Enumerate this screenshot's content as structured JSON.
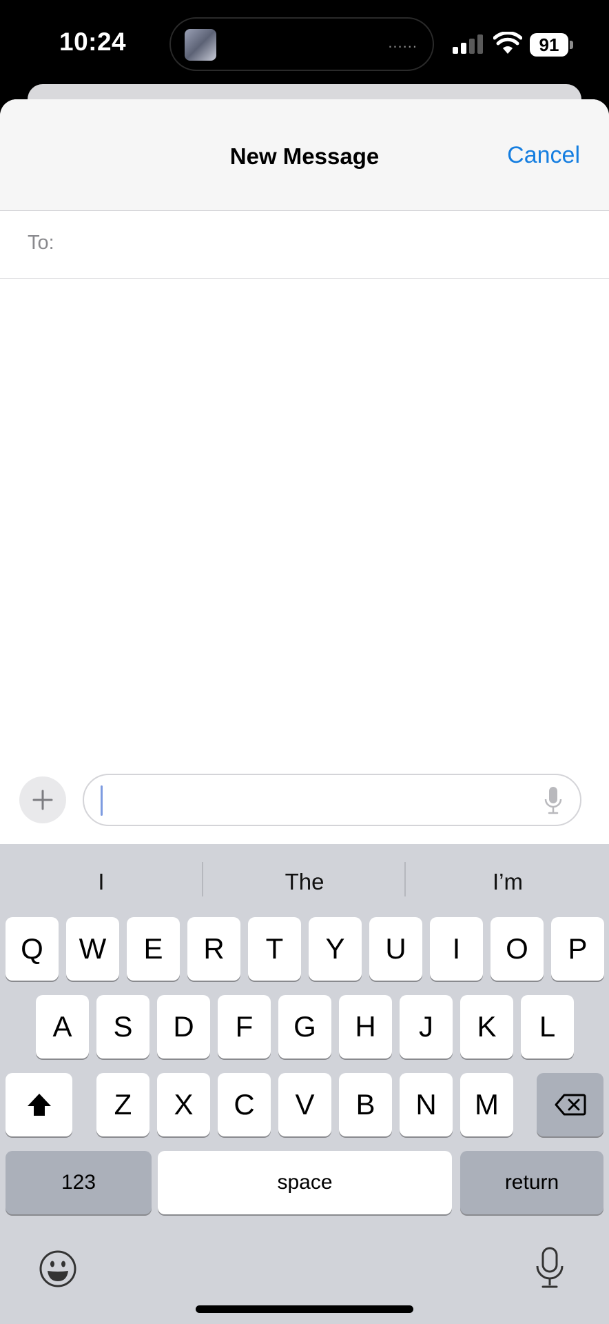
{
  "status_bar": {
    "time": "10:24",
    "battery": "91",
    "island_dots": "......"
  },
  "sheet": {
    "title": "New Message",
    "cancel_label": "Cancel",
    "to_label": "To:",
    "to_value": ""
  },
  "compose": {
    "message_value": ""
  },
  "keyboard": {
    "suggestions": [
      "I",
      "The",
      "I’m"
    ],
    "row1": [
      "Q",
      "W",
      "E",
      "R",
      "T",
      "Y",
      "U",
      "I",
      "O",
      "P"
    ],
    "row2": [
      "A",
      "S",
      "D",
      "F",
      "G",
      "H",
      "J",
      "K",
      "L"
    ],
    "row3": [
      "Z",
      "X",
      "C",
      "V",
      "B",
      "N",
      "M"
    ],
    "numbers_label": "123",
    "space_label": "space",
    "return_label": "return"
  },
  "colors": {
    "accent": "#157ee0",
    "keyboard_bg": "#d1d3d9",
    "key_bg": "#ffffff",
    "key_gray": "#abb0ba"
  }
}
